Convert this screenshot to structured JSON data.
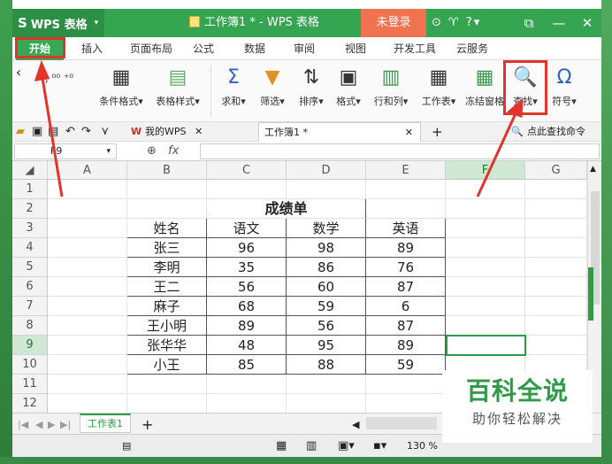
{
  "app": {
    "logo_label": "WPS 表格",
    "document_title": "工作簿1 * - WPS 表格",
    "login_label": "未登录"
  },
  "tabs": [
    "开始",
    "插入",
    "页面布局",
    "公式",
    "数据",
    "审阅",
    "视图",
    "开发工具",
    "云服务"
  ],
  "ribbon": {
    "conditional_format": "条件格式",
    "table_style": "表格样式",
    "sum": "求和",
    "filter": "筛选",
    "sort": "排序",
    "format": "格式",
    "row_col": "行和列",
    "worksheet": "工作表",
    "freeze": "冻结窗格",
    "find": "查找",
    "symbol": "符号"
  },
  "quickbar": {
    "my_wps": "我的WPS",
    "doc_tab": "工作簿1 *",
    "search_hint": "点此查找命令"
  },
  "formula": {
    "cell_ref": "F9",
    "fx_label": "fx",
    "value": ""
  },
  "grid": {
    "columns": [
      "A",
      "B",
      "C",
      "D",
      "E",
      "F",
      "G"
    ],
    "rows": [
      "1",
      "2",
      "3",
      "4",
      "5",
      "6",
      "7",
      "8",
      "9",
      "10",
      "11",
      "12"
    ],
    "sheet_title": "成绩单",
    "headers": [
      "姓名",
      "语文",
      "数学",
      "英语"
    ],
    "data": [
      [
        "张三",
        "96",
        "98",
        "89"
      ],
      [
        "李明",
        "35",
        "86",
        "76"
      ],
      [
        "王二",
        "56",
        "60",
        "87"
      ],
      [
        "麻子",
        "68",
        "59",
        "6"
      ],
      [
        "王小明",
        "89",
        "56",
        "87"
      ],
      [
        "张华华",
        "48",
        "95",
        "89"
      ],
      [
        "小王",
        "85",
        "88",
        "59"
      ]
    ],
    "selected_cell": "F9"
  },
  "sheets": [
    "工作表1"
  ],
  "status": {
    "zoom": "130 %"
  },
  "watermark": {
    "title": "百科全说",
    "subtitle": "助你轻松解决"
  },
  "colors": {
    "accent": "#36a552",
    "highlight": "#e0342c"
  }
}
